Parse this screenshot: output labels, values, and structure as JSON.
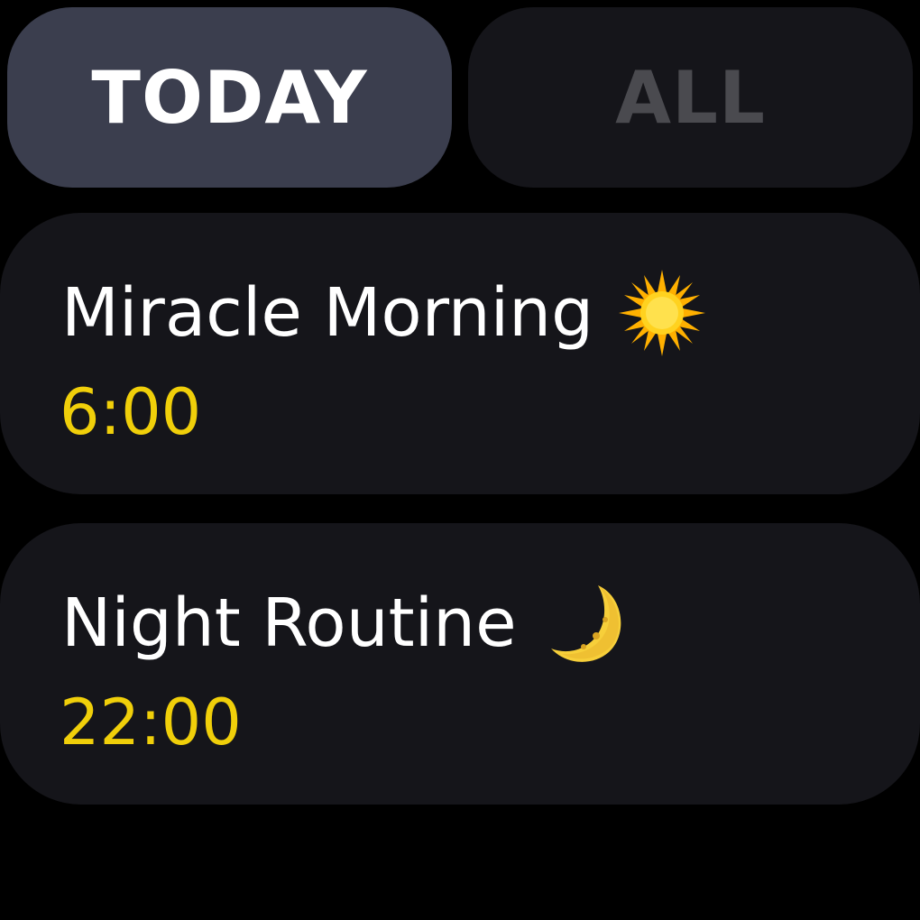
{
  "tabs": [
    {
      "label": "TODAY",
      "active": true
    },
    {
      "label": "ALL",
      "active": false
    }
  ],
  "routines": [
    {
      "title": "Miracle Morning",
      "icon": "sun-icon",
      "time": "6:00"
    },
    {
      "title": "Night Routine",
      "icon": "crescent-moon-icon",
      "time": "22:00"
    }
  ],
  "colors": {
    "background": "#000000",
    "card": "#15151a",
    "active_tab": "#3b3e4e",
    "inactive_tab_text": "#4a4a4f",
    "time": "#f0cf0a",
    "sun": "#ffc31f",
    "moon": "#f7d24a"
  }
}
